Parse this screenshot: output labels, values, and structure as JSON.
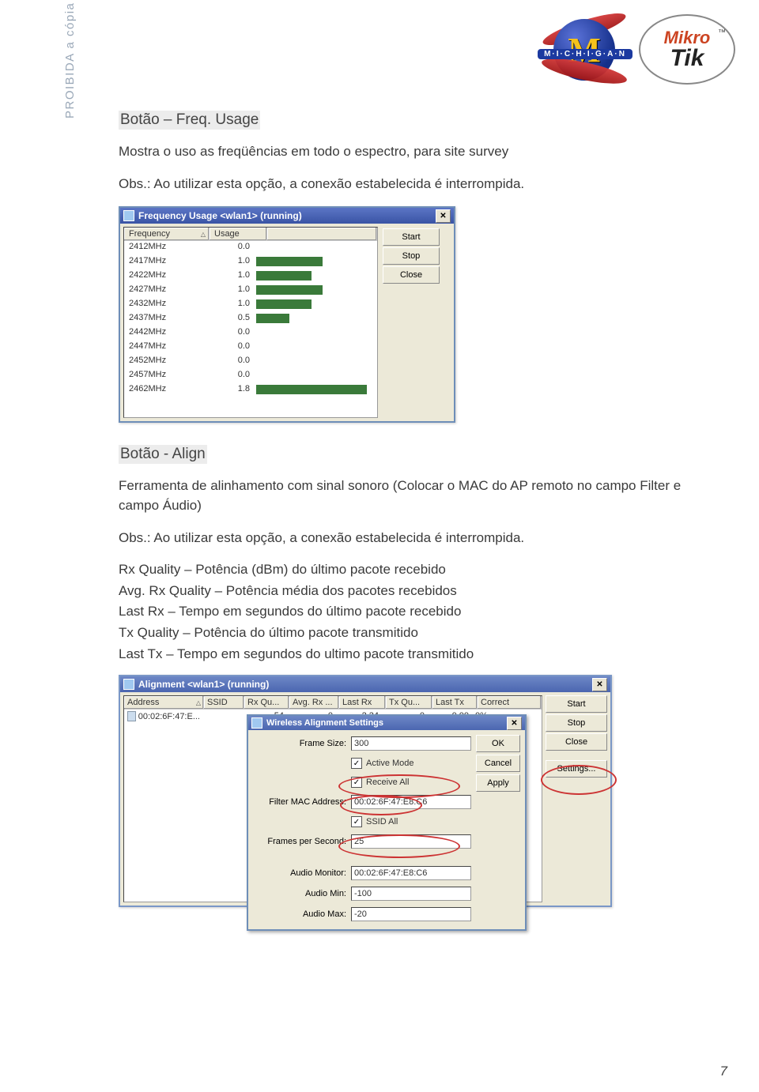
{
  "header": {
    "logo1_band": "M·I·C·H·I·G·A·N",
    "logo1_letter": "M",
    "logo2_top": "Mikro",
    "logo2_bottom": "Tik",
    "logo2_tm": "™"
  },
  "sidebar_text": "PROIBIDA a cópia total ou parcial deste guia exclusivo de referência, sem autorização do autor.",
  "section1": {
    "title": "Botão – Freq. Usage",
    "p1": "Mostra o uso as freqüências em todo o espectro, para site survey",
    "p2": "Obs.: Ao utilizar esta opção, a conexão estabelecida é interrompida."
  },
  "freq_window": {
    "title": "Frequency Usage <wlan1> (running)",
    "columns": {
      "c1": "Frequency",
      "c2": "Usage"
    },
    "rows": [
      {
        "freq": "2412MHz",
        "usage": "0.0",
        "bar": 0
      },
      {
        "freq": "2417MHz",
        "usage": "1.0",
        "bar": 6
      },
      {
        "freq": "2422MHz",
        "usage": "1.0",
        "bar": 5
      },
      {
        "freq": "2427MHz",
        "usage": "1.0",
        "bar": 6
      },
      {
        "freq": "2432MHz",
        "usage": "1.0",
        "bar": 5
      },
      {
        "freq": "2437MHz",
        "usage": "0.5",
        "bar": 3
      },
      {
        "freq": "2442MHz",
        "usage": "0.0",
        "bar": 0
      },
      {
        "freq": "2447MHz",
        "usage": "0.0",
        "bar": 0
      },
      {
        "freq": "2452MHz",
        "usage": "0.0",
        "bar": 0
      },
      {
        "freq": "2457MHz",
        "usage": "0.0",
        "bar": 0
      },
      {
        "freq": "2462MHz",
        "usage": "1.8",
        "bar": 10
      }
    ],
    "buttons": {
      "start": "Start",
      "stop": "Stop",
      "close": "Close"
    }
  },
  "section2": {
    "title": "Botão - Align",
    "p1": "Ferramenta de alinhamento com sinal sonoro (Colocar o MAC do AP remoto no campo Filter e campo Áudio)",
    "p2": "Obs.: Ao utilizar esta opção, a conexão estabelecida é interrompida.",
    "p3": "Rx Quality – Potência (dBm) do último pacote recebido",
    "p4": "Avg. Rx Quality – Potência média dos pacotes recebidos",
    "p5": "Last Rx – Tempo em segundos do último pacote recebido",
    "p6": "Tx Quality – Potência do último pacote transmitido",
    "p7": "Last Tx – Tempo em segundos do ultimo pacote transmitido"
  },
  "align_window": {
    "title": "Alignment <wlan1> (running)",
    "columns": {
      "addr": "Address",
      "ssid": "SSID",
      "rx": "Rx Qu...",
      "avg": "Avg. Rx ...",
      "lastrx": "Last Rx",
      "tx": "Tx Qu...",
      "lasttx": "Last Tx",
      "correct": "Correct"
    },
    "row": {
      "addr": "00:02:6F:47:E...",
      "ssid": "",
      "rx": "-54",
      "avg": "0",
      "lastrx": "2.34",
      "tx": "0",
      "lasttx": "0.00",
      "correct": "0%"
    },
    "buttons": {
      "start": "Start",
      "stop": "Stop",
      "close": "Close",
      "settings": "Settings..."
    },
    "dialog": {
      "title": "Wireless Alignment Settings",
      "labels": {
        "frame_size": "Frame Size:",
        "active_mode": "Active Mode",
        "receive_all": "Receive All",
        "filter_mac": "Filter MAC Address:",
        "ssid_all": "SSID All",
        "fps": "Frames per Second:",
        "audio_monitor": "Audio Monitor:",
        "audio_min": "Audio Min:",
        "audio_max": "Audio Max:"
      },
      "values": {
        "frame_size": "300",
        "filter_mac": "00:02:6F:47:E8:C6",
        "fps": "25",
        "audio_monitor": "00:02:6F:47:E8:C6",
        "audio_min": "-100",
        "audio_max": "-20"
      },
      "buttons": {
        "ok": "OK",
        "cancel": "Cancel",
        "apply": "Apply"
      }
    }
  },
  "page_number": "7"
}
